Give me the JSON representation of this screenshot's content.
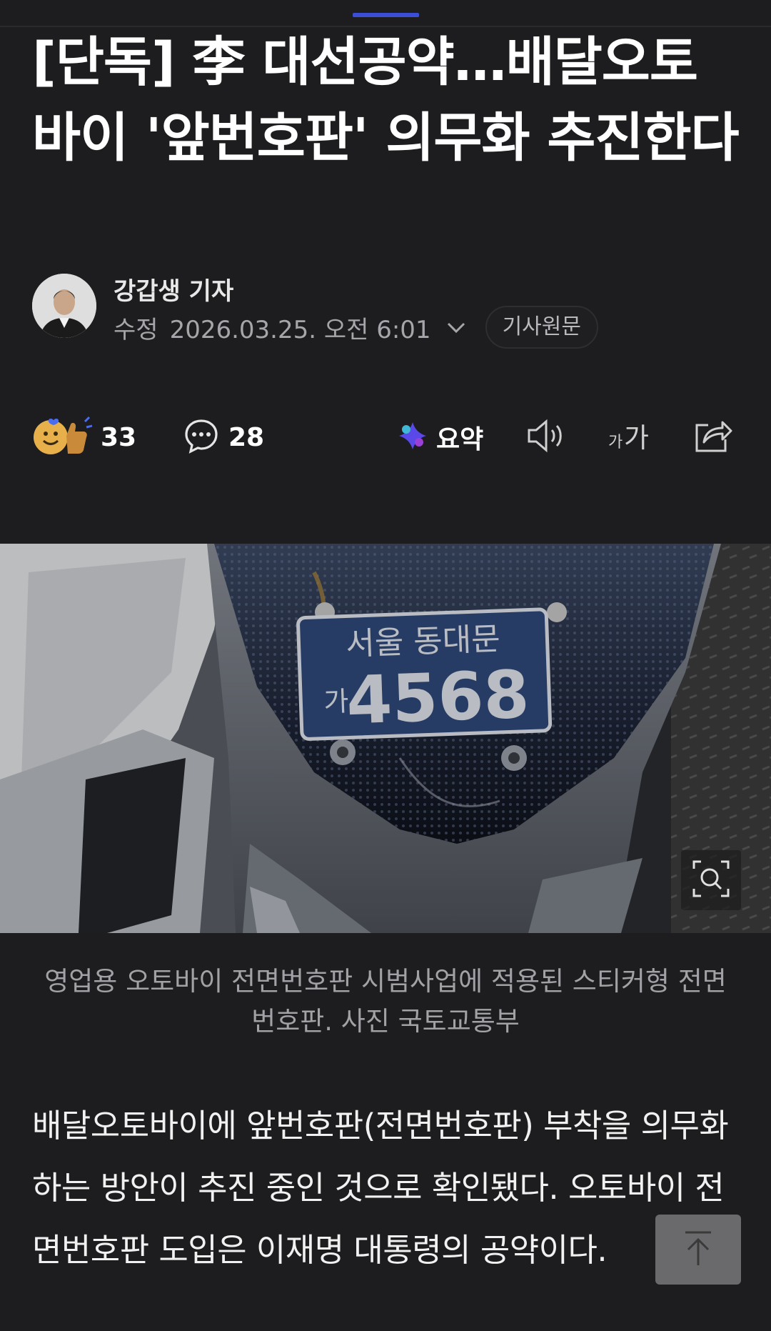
{
  "article": {
    "headline": "[단독] 李 대선공약…배달오토바이 '앞번호판' 의무화 추진한다",
    "reporter": "강갑생 기자",
    "modified_label": "수정",
    "datetime": "2026.03.25. 오전 6:01",
    "origin_button": "기사원문"
  },
  "actions": {
    "reactions_count": "33",
    "comments_count": "28",
    "summary_label": "요약",
    "listen_icon": "speaker-icon",
    "font_size_icon": "font-size-icon",
    "share_icon": "share-icon"
  },
  "photo": {
    "plate_region": "서울 동대문",
    "plate_prefix": "가",
    "plate_number": "4568",
    "caption": "영업용 오토바이 전면번호판 시범사업에 적용된 스티커형 전면번호판. 사진 국토교통부"
  },
  "body": {
    "paragraph": "배달오토바이에 앞번호판(전면번호판) 부착을 의무화하는 방안이 추진 중인 것으로 확인됐다. 오토바이 전면번호판 도입은 이재명 대통령의 공약이다."
  },
  "colors": {
    "background": "#1d1d1f",
    "tab_accent": "#3a4fd6",
    "muted_text": "#a6a6aa"
  }
}
